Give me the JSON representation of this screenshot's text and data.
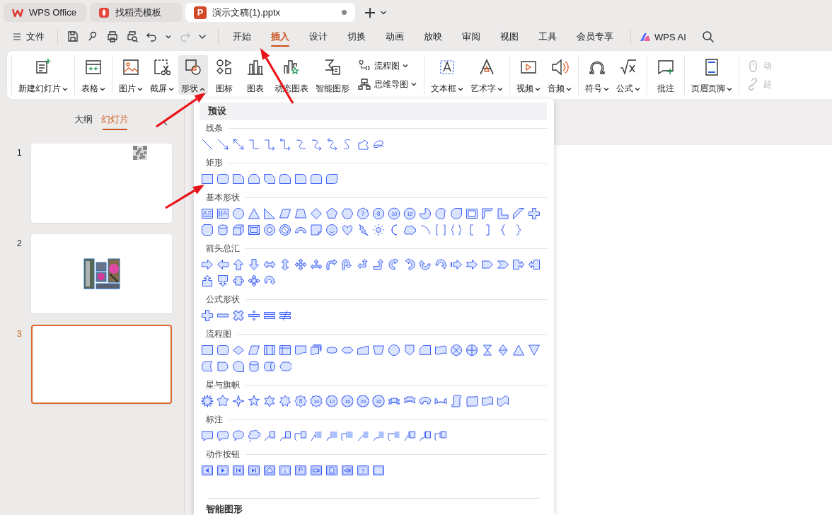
{
  "document_tabs": [
    {
      "label": "WPS Office",
      "selected": false,
      "modified": false
    },
    {
      "label": "找稻壳模板",
      "selected": false,
      "modified": false
    },
    {
      "label": "演示文稿(1).pptx",
      "badge": "P",
      "selected": true,
      "modified": true
    }
  ],
  "menu_bar": {
    "file_label": "文件",
    "tabs": [
      {
        "label": "开始",
        "selected": false
      },
      {
        "label": "插入",
        "selected": true
      },
      {
        "label": "设计",
        "selected": false
      },
      {
        "label": "切换",
        "selected": false
      },
      {
        "label": "动画",
        "selected": false
      },
      {
        "label": "放映",
        "selected": false
      },
      {
        "label": "审阅",
        "selected": false
      },
      {
        "label": "视图",
        "selected": false
      },
      {
        "label": "工具",
        "selected": false
      },
      {
        "label": "会员专享",
        "selected": false
      }
    ],
    "ai_label": "WPS AI"
  },
  "ribbon": {
    "groups": [
      {
        "items": [
          {
            "kind": "large",
            "label": "新建幻灯片",
            "has_menu": true,
            "expanded": false,
            "selected": false,
            "disabled": false
          }
        ]
      },
      {
        "items": [
          {
            "kind": "large",
            "label": "表格",
            "has_menu": true,
            "expanded": false,
            "selected": false,
            "disabled": false
          }
        ]
      },
      {
        "items": [
          {
            "kind": "large",
            "label": "图片",
            "has_menu": true,
            "expanded": false,
            "selected": false,
            "disabled": false
          },
          {
            "kind": "large",
            "label": "截屏",
            "has_menu": true,
            "expanded": false,
            "selected": false,
            "disabled": false
          },
          {
            "kind": "large",
            "label": "形状",
            "has_menu": true,
            "expanded": true,
            "selected": true,
            "disabled": false
          },
          {
            "kind": "large",
            "label": "图标",
            "has_menu": false,
            "selected": false,
            "disabled": false
          },
          {
            "kind": "large",
            "label": "图表",
            "has_menu": false,
            "selected": false,
            "disabled": false
          },
          {
            "kind": "large",
            "label": "动态图表",
            "has_menu": false,
            "selected": false,
            "disabled": false
          },
          {
            "kind": "large",
            "label": "智能图形",
            "has_menu": false,
            "selected": false,
            "disabled": false
          },
          {
            "kind": "small",
            "label": "流程图",
            "has_menu": true,
            "expanded": false,
            "selected": false,
            "disabled": false
          },
          {
            "kind": "small",
            "label": "思维导图",
            "has_menu": true,
            "expanded": false,
            "selected": false,
            "disabled": false
          }
        ]
      },
      {
        "items": [
          {
            "kind": "large",
            "label": "文本框",
            "has_menu": true,
            "expanded": false,
            "selected": false,
            "disabled": false
          },
          {
            "kind": "large",
            "label": "艺术字",
            "has_menu": true,
            "expanded": false,
            "selected": false,
            "disabled": false
          }
        ]
      },
      {
        "items": [
          {
            "kind": "large",
            "label": "视频",
            "has_menu": true,
            "expanded": false,
            "selected": false,
            "disabled": false
          },
          {
            "kind": "large",
            "label": "音频",
            "has_menu": true,
            "expanded": false,
            "selected": false,
            "disabled": false
          }
        ]
      },
      {
        "items": [
          {
            "kind": "large",
            "label": "符号",
            "has_menu": true,
            "expanded": false,
            "selected": false,
            "disabled": false
          },
          {
            "kind": "large",
            "label": "公式",
            "has_menu": true,
            "expanded": false,
            "selected": false,
            "disabled": false
          }
        ]
      },
      {
        "items": [
          {
            "kind": "large",
            "label": "批注",
            "has_menu": false,
            "selected": false,
            "disabled": false
          }
        ]
      },
      {
        "items": [
          {
            "kind": "large",
            "label": "页眉页脚",
            "has_menu": true,
            "expanded": false,
            "selected": false,
            "disabled": false
          }
        ]
      },
      {
        "items": [
          {
            "kind": "small",
            "label": "动",
            "has_menu": false,
            "selected": false,
            "disabled": true
          },
          {
            "kind": "small",
            "label": "超",
            "has_menu": false,
            "selected": false,
            "disabled": true
          }
        ]
      }
    ]
  },
  "slide_panel": {
    "tabs": [
      {
        "label": "大纲",
        "selected": false
      },
      {
        "label": "幻灯片",
        "selected": true
      }
    ],
    "slides": [
      {
        "number": "1",
        "kind": "qr-code",
        "selected": false
      },
      {
        "number": "2",
        "kind": "picture",
        "selected": false
      },
      {
        "number": "3",
        "kind": "blank",
        "selected": true
      }
    ]
  },
  "shape_menu": {
    "header": "预设",
    "sections": [
      {
        "title": "线条",
        "shapes": [
          {
            "kind": "line"
          },
          {
            "kind": "arrow-line"
          },
          {
            "kind": "double-arrow-line"
          },
          {
            "kind": "elbow-connector"
          },
          {
            "kind": "elbow-arrow-connector"
          },
          {
            "kind": "elbow-double-arrow-connector"
          },
          {
            "kind": "curved-connector"
          },
          {
            "kind": "curved-arrow-connector"
          },
          {
            "kind": "curved-double-arrow-connector"
          },
          {
            "kind": "curve"
          },
          {
            "kind": "freeform"
          },
          {
            "kind": "scribble"
          }
        ]
      },
      {
        "title": "矩形",
        "shapes": [
          {
            "kind": "rectangle"
          },
          {
            "kind": "rounded-rectangle"
          },
          {
            "kind": "snip-corner-rectangle"
          },
          {
            "kind": "snip-same-side-rectangle"
          },
          {
            "kind": "snip-diagonal-rectangle"
          },
          {
            "kind": "snip-round-rectangle"
          },
          {
            "kind": "round-corner-rectangle"
          },
          {
            "kind": "round-same-side-rectangle"
          },
          {
            "kind": "round-diagonal-rectangle"
          }
        ]
      },
      {
        "title": "基本形状",
        "shapes": [
          {
            "kind": "textbox",
            "label": "A"
          },
          {
            "kind": "vertical-textbox",
            "label": "A"
          },
          {
            "kind": "oval"
          },
          {
            "kind": "triangle"
          },
          {
            "kind": "right-triangle"
          },
          {
            "kind": "parallelogram"
          },
          {
            "kind": "trapezoid"
          },
          {
            "kind": "diamond"
          },
          {
            "kind": "pentagon"
          },
          {
            "kind": "hexagon"
          },
          {
            "kind": "heptagon",
            "label": "7"
          },
          {
            "kind": "octagon",
            "label": "8"
          },
          {
            "kind": "decagon",
            "label": "10"
          },
          {
            "kind": "dodecagon",
            "label": "12"
          },
          {
            "kind": "pie"
          },
          {
            "kind": "chord"
          },
          {
            "kind": "teardrop"
          },
          {
            "kind": "frame"
          },
          {
            "kind": "half-frame"
          },
          {
            "kind": "l-shape"
          },
          {
            "kind": "diagonal-stripe"
          },
          {
            "kind": "cross"
          },
          {
            "kind": "plaque"
          },
          {
            "kind": "can"
          },
          {
            "kind": "cube"
          },
          {
            "kind": "bevel"
          },
          {
            "kind": "donut"
          },
          {
            "kind": "no-symbol"
          },
          {
            "kind": "block-arc"
          },
          {
            "kind": "folded-corner"
          },
          {
            "kind": "smiley"
          },
          {
            "kind": "heart"
          },
          {
            "kind": "lightning"
          },
          {
            "kind": "sun"
          },
          {
            "kind": "moon"
          },
          {
            "kind": "cloud"
          },
          {
            "kind": "arc"
          },
          {
            "kind": "double-bracket"
          },
          {
            "kind": "double-brace"
          },
          {
            "kind": "left-bracket"
          },
          {
            "kind": "right-bracket"
          },
          {
            "kind": "left-brace"
          },
          {
            "kind": "right-brace"
          }
        ]
      },
      {
        "title": "箭头总汇",
        "shapes": [
          {
            "kind": "right-arrow"
          },
          {
            "kind": "left-arrow"
          },
          {
            "kind": "up-arrow"
          },
          {
            "kind": "down-arrow"
          },
          {
            "kind": "left-right-arrow"
          },
          {
            "kind": "up-down-arrow"
          },
          {
            "kind": "quad-arrow"
          },
          {
            "kind": "left-right-up-arrow"
          },
          {
            "kind": "bent-arrow"
          },
          {
            "kind": "u-turn-arrow"
          },
          {
            "kind": "left-up-arrow"
          },
          {
            "kind": "bent-up-arrow"
          },
          {
            "kind": "curved-right-arrow"
          },
          {
            "kind": "curved-left-arrow"
          },
          {
            "kind": "curved-up-arrow"
          },
          {
            "kind": "curved-down-arrow"
          },
          {
            "kind": "striped-right-arrow"
          },
          {
            "kind": "notched-right-arrow"
          },
          {
            "kind": "pentagon-arrow"
          },
          {
            "kind": "chevron"
          },
          {
            "kind": "right-arrow-callout"
          },
          {
            "kind": "left-arrow-callout"
          },
          {
            "kind": "up-arrow-callout"
          },
          {
            "kind": "down-arrow-callout"
          },
          {
            "kind": "left-right-arrow-callout"
          },
          {
            "kind": "quad-arrow-callout"
          },
          {
            "kind": "circular-arrow"
          }
        ]
      },
      {
        "title": "公式形状",
        "shapes": [
          {
            "kind": "plus"
          },
          {
            "kind": "minus"
          },
          {
            "kind": "multiply"
          },
          {
            "kind": "divide"
          },
          {
            "kind": "equal"
          },
          {
            "kind": "not-equal"
          }
        ]
      },
      {
        "title": "流程图",
        "shapes": [
          {
            "kind": "process"
          },
          {
            "kind": "alternate-process"
          },
          {
            "kind": "decision"
          },
          {
            "kind": "data"
          },
          {
            "kind": "predefined-process"
          },
          {
            "kind": "internal-storage"
          },
          {
            "kind": "document"
          },
          {
            "kind": "multidocument"
          },
          {
            "kind": "terminator"
          },
          {
            "kind": "preparation"
          },
          {
            "kind": "manual-input"
          },
          {
            "kind": "manual-operation"
          },
          {
            "kind": "connector"
          },
          {
            "kind": "off-page-connector"
          },
          {
            "kind": "card"
          },
          {
            "kind": "punched-tape"
          },
          {
            "kind": "summing-junction"
          },
          {
            "kind": "or"
          },
          {
            "kind": "collate"
          },
          {
            "kind": "sort"
          },
          {
            "kind": "extract"
          },
          {
            "kind": "merge"
          },
          {
            "kind": "stored-data"
          },
          {
            "kind": "delay"
          },
          {
            "kind": "sequential-access-storage"
          },
          {
            "kind": "magnetic-disk"
          },
          {
            "kind": "direct-access-storage"
          },
          {
            "kind": "display"
          }
        ]
      },
      {
        "title": "星与旗帜",
        "shapes": [
          {
            "kind": "explosion"
          },
          {
            "kind": "burst"
          },
          {
            "kind": "star-4"
          },
          {
            "kind": "star-5"
          },
          {
            "kind": "star-6"
          },
          {
            "kind": "star-7"
          },
          {
            "kind": "star-8",
            "label": "8"
          },
          {
            "kind": "star-10",
            "label": "10"
          },
          {
            "kind": "star-12",
            "label": "12"
          },
          {
            "kind": "star-16",
            "label": "16"
          },
          {
            "kind": "star-24",
            "label": "24"
          },
          {
            "kind": "star-32",
            "label": "32"
          },
          {
            "kind": "ribbon"
          },
          {
            "kind": "ribbon-down"
          },
          {
            "kind": "curved-ribbon"
          },
          {
            "kind": "curved-ribbon-down"
          },
          {
            "kind": "vertical-scroll"
          },
          {
            "kind": "horizontal-scroll"
          },
          {
            "kind": "wave"
          },
          {
            "kind": "double-wave"
          }
        ]
      },
      {
        "title": "标注",
        "shapes": [
          {
            "kind": "rectangle-callout"
          },
          {
            "kind": "rounded-rectangle-callout"
          },
          {
            "kind": "oval-callout"
          },
          {
            "kind": "cloud-callout"
          },
          {
            "kind": "line-callout"
          },
          {
            "kind": "bent-line-callout"
          },
          {
            "kind": "double-bent-callout"
          },
          {
            "kind": "accent-line-callout"
          },
          {
            "kind": "accent-bent-callout"
          },
          {
            "kind": "accent-double-callout"
          },
          {
            "kind": "borderless-line-callout"
          },
          {
            "kind": "borderless-bent-callout"
          },
          {
            "kind": "borderless-double-callout"
          },
          {
            "kind": "bordered-line-callout"
          },
          {
            "kind": "bordered-bent-callout"
          },
          {
            "kind": "bordered-double-callout"
          }
        ]
      },
      {
        "title": "动作按钮",
        "shapes": [
          {
            "kind": "back-button"
          },
          {
            "kind": "forward-button"
          },
          {
            "kind": "beginning-button"
          },
          {
            "kind": "end-button"
          },
          {
            "kind": "home-button"
          },
          {
            "kind": "info-button",
            "label": "i"
          },
          {
            "kind": "return-button"
          },
          {
            "kind": "movie-button"
          },
          {
            "kind": "document-button"
          },
          {
            "kind": "sound-button"
          },
          {
            "kind": "help-button",
            "label": "?"
          },
          {
            "kind": "custom-button"
          }
        ]
      }
    ],
    "footer_title": "智能图形"
  }
}
